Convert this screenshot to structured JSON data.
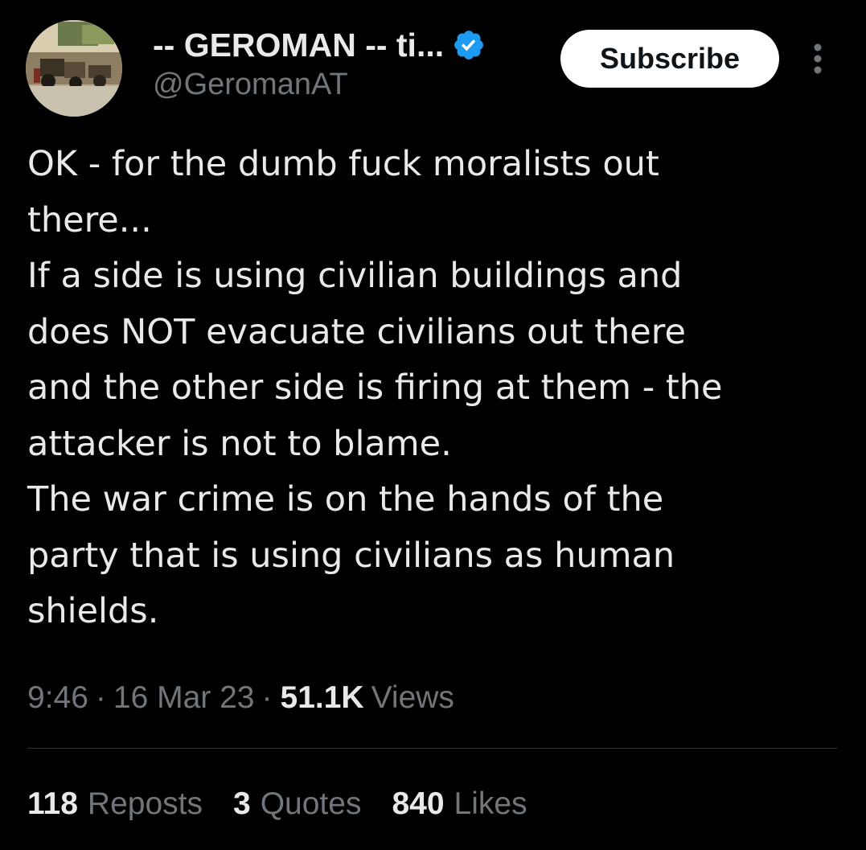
{
  "author": {
    "display_name": "-- GEROMAN -- ti...",
    "handle": "@GeromanAT",
    "verified_icon": "verified-badge-icon",
    "badge_color": "#1d9bf0"
  },
  "actions": {
    "subscribe_label": "Subscribe",
    "more_icon": "more-vertical-icon"
  },
  "tweet": {
    "lines": [
      "OK - for the dumb fuck moralists out",
      "there...",
      "If a side is using civilian buildings and",
      "does NOT evacuate civilians out there",
      "and the other side is firing at them - the",
      "attacker is not to blame.",
      "The war crime is on the hands of the",
      "party that is using civilians as human",
      "shields."
    ]
  },
  "meta": {
    "time": "9:46",
    "separator": "·",
    "date": "16 Mar 23",
    "views_count": "51.1K",
    "views_label": "Views"
  },
  "stats": {
    "reposts_count": "118",
    "reposts_label": "Reposts",
    "quotes_count": "3",
    "quotes_label": "Quotes",
    "likes_count": "840",
    "likes_label": "Likes"
  },
  "colors": {
    "background": "#000000",
    "text_primary": "#e7e9ea",
    "text_secondary": "#71767b",
    "divider": "#2f3336",
    "button_bg": "#ffffff"
  }
}
